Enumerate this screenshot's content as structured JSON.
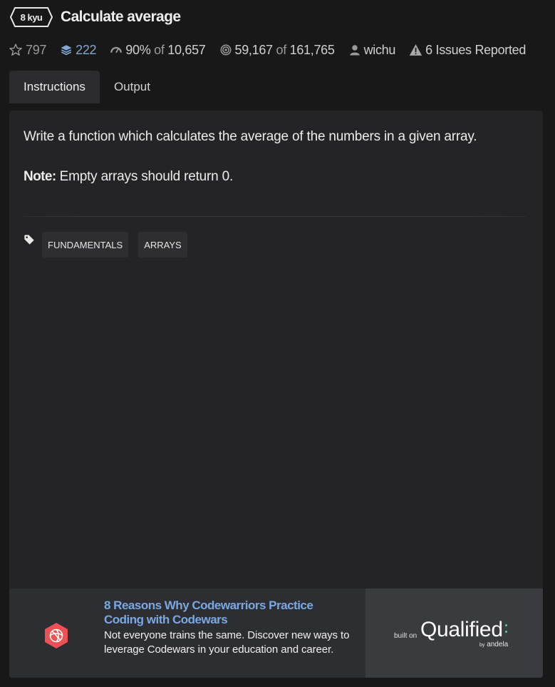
{
  "kata": {
    "rank": "8 kyu",
    "title": "Calculate average"
  },
  "stats": {
    "stars": "797",
    "collections": "222",
    "satisfaction": "90%",
    "satisfaction_of": "of",
    "votes": "10,657",
    "completed": "59,167",
    "completed_of": "of",
    "attempts": "161,765",
    "author": "wichu",
    "issues": "6 Issues Reported"
  },
  "tabs": [
    {
      "label": "Instructions",
      "active": true
    },
    {
      "label": "Output",
      "active": false
    }
  ],
  "description": {
    "text": "Write a function which calculates the average of the numbers in a given array.",
    "note_label": "Note:",
    "note_text": " Empty arrays should return 0."
  },
  "tags": [
    "FUNDAMENTALS",
    "ARRAYS"
  ],
  "ad": {
    "title": "8 Reasons Why Codewarriors Practice Coding with Codewars",
    "text": "Not everyone trains the same. Discover new ways to leverage Codewars in your education and career.",
    "built_on": "built on",
    "brand": "Qualified",
    "by": "by",
    "partner": "andela"
  },
  "icons": {
    "stars": "star-outline-icon",
    "collections": "layers-icon",
    "satisfaction": "gauge-icon",
    "completed": "target-icon",
    "author": "user-icon",
    "issues": "warning-icon",
    "tags": "tag-icon",
    "ad_logo": "codewars-logo"
  },
  "colors": {
    "background": "#181818",
    "panel": "#242426",
    "tab_active": "#2c2c2f",
    "link": "#7aa8e3",
    "ad_logo": "#ec5154",
    "qualified_accent": "#4ad3a8"
  }
}
